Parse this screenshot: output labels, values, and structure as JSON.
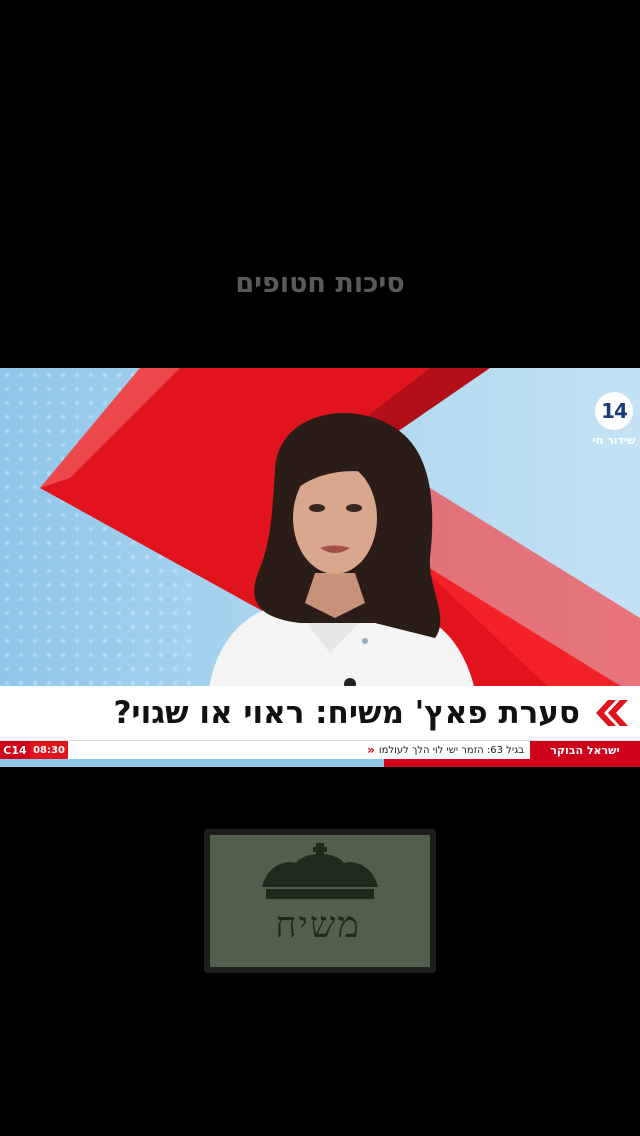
{
  "video_caption": "סיכות חטופים",
  "channel": {
    "logo_number": "14",
    "live_label": "שידור חי"
  },
  "headline": {
    "text": "סערת פאץ' משיח: ראוי או שגוי?"
  },
  "ticker": {
    "channel_tag": "C14",
    "time": "08:30",
    "news_item": "בגיל 63: הזמר ישי לוי הלך לעולמו",
    "show_name": "ישראל הבוקר"
  },
  "patch": {
    "text": "משיח",
    "icon": "crown-icon"
  },
  "colors": {
    "accent_red": "#e1141e",
    "studio_blue": "#a9d4ef",
    "patch_green": "#56634f"
  }
}
